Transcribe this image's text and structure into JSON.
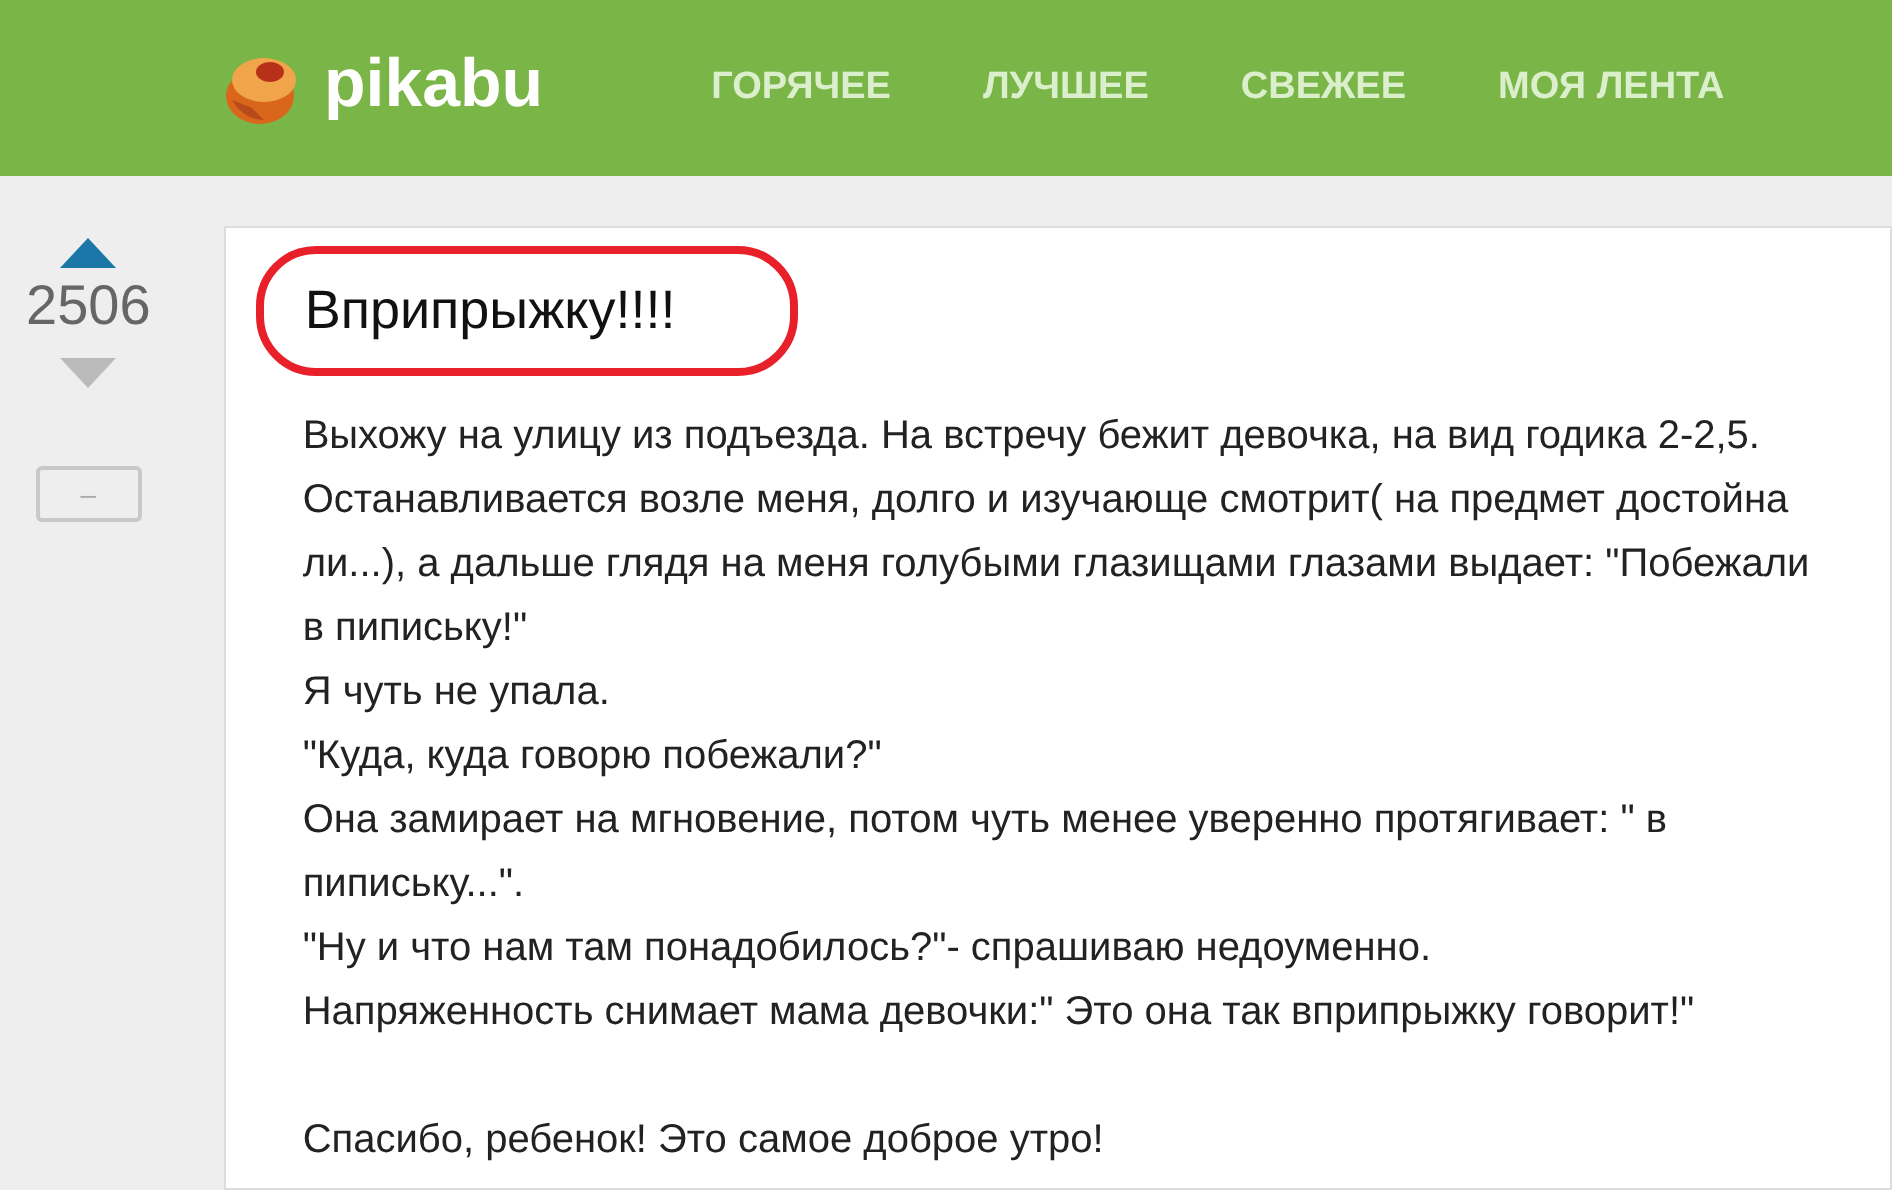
{
  "header": {
    "logo_text": "pikabu",
    "nav": [
      "ГОРЯЧЕЕ",
      "ЛУЧШЕЕ",
      "СВЕЖЕЕ",
      "МОЯ ЛЕНТА"
    ]
  },
  "vote": {
    "rating": "2506",
    "collapse_label": "–"
  },
  "post": {
    "title": "Вприпрыжку!!!!",
    "paragraphs": [
      "Выхожу на улицу из подъезда. На встречу бежит девочка, на вид годика 2-2,5. Останавливается возле меня, долго и изучающе смотрит( на предмет достойна ли...), а дальше глядя на меня голубыми глазищами глазами выдает: \"Побежали в пипиську!\"",
      "Я чуть не упала.",
      "\"Куда, куда говорю побежали?\"",
      "Она замирает на мгновение, потом чуть менее уверенно протягивает: \" в пипиську...\".",
      "\"Ну и что нам там понадобилось?\"- спрашиваю недоуменно.",
      "Напряженность снимает мама девочки:\" Это она так вприпрыжку говорит!\"",
      "Спасибо, ребенок! Это самое доброе утро!"
    ]
  }
}
